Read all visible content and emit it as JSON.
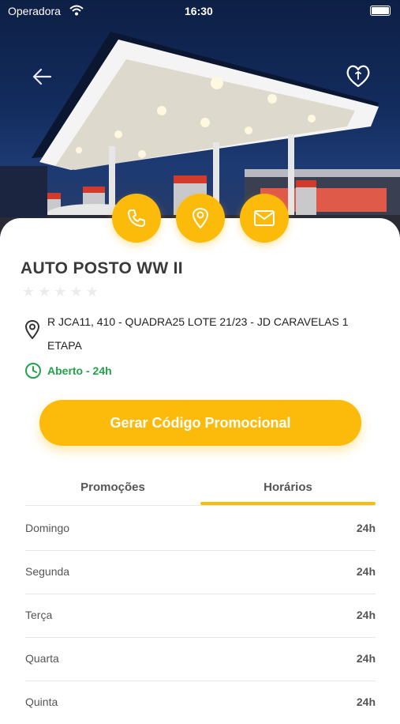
{
  "status_bar": {
    "carrier": "Operadora",
    "time": "16:30"
  },
  "station": {
    "name": "AUTO POSTO WW II",
    "rating": 0,
    "address": "R JCA11, 410 - QUADRA25 LOTE 21/23 - JD CARAVELAS 1 ETAPA",
    "status": "Aberto - 24h"
  },
  "actions": {
    "promo_button": "Gerar Código Promocional"
  },
  "tabs": [
    {
      "label": "Promoções",
      "active": false
    },
    {
      "label": "Horários",
      "active": true
    }
  ],
  "schedule": [
    {
      "day": "Domingo",
      "hours": "24h"
    },
    {
      "day": "Segunda",
      "hours": "24h"
    },
    {
      "day": "Terça",
      "hours": "24h"
    },
    {
      "day": "Quarta",
      "hours": "24h"
    },
    {
      "day": "Quinta",
      "hours": "24h"
    }
  ],
  "colors": {
    "accent": "#fcbb0a",
    "open": "#22a24a"
  },
  "icons": [
    "back-arrow-icon",
    "heart-icon",
    "phone-icon",
    "location-pin-icon",
    "mail-icon",
    "map-pin-icon",
    "clock-icon"
  ]
}
